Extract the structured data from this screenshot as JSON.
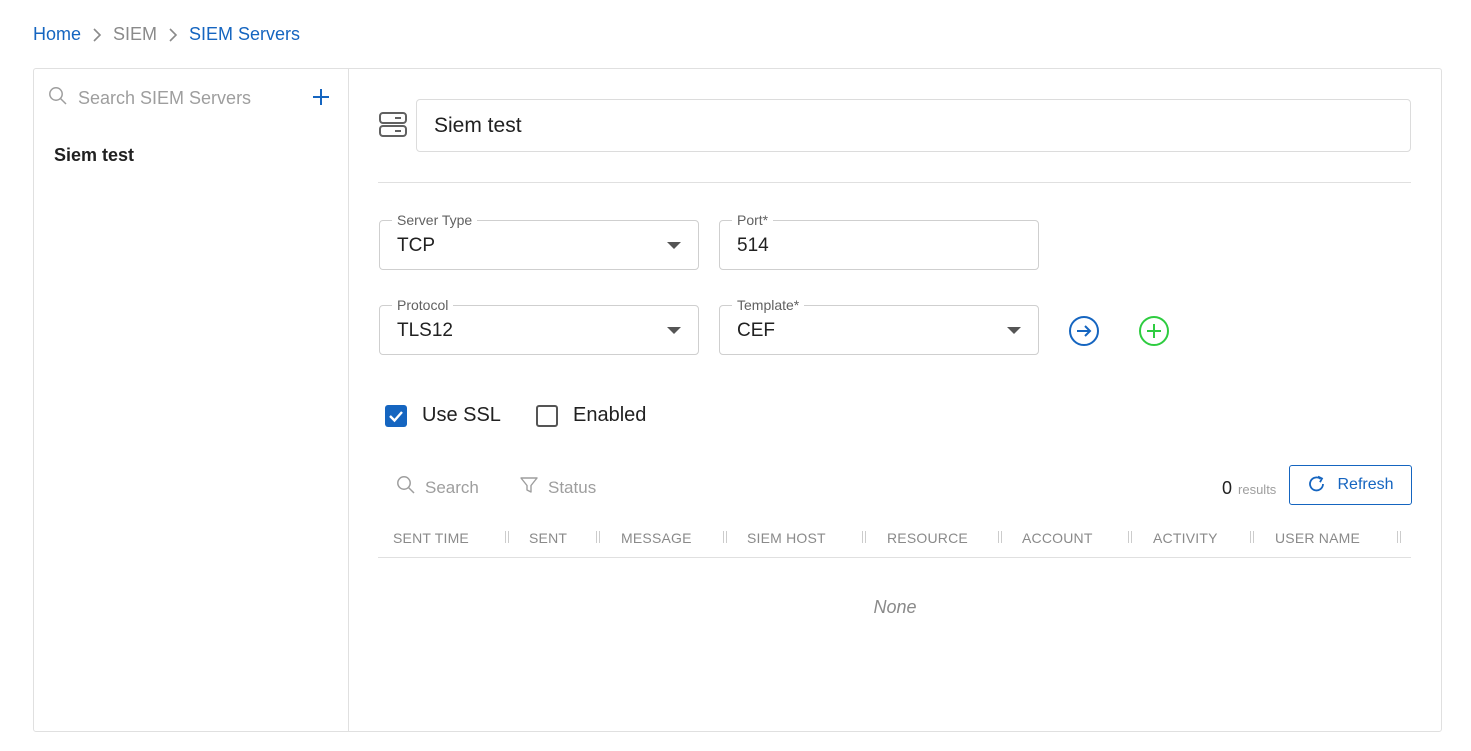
{
  "breadcrumb": [
    {
      "label": "Home"
    },
    {
      "label": "SIEM"
    },
    {
      "label": "SIEM Servers"
    }
  ],
  "sidebar": {
    "search_placeholder": "Search SIEM Servers",
    "items": [
      {
        "label": "Siem test"
      }
    ]
  },
  "server": {
    "name": "Siem test"
  },
  "form": {
    "server_type": {
      "label": "Server Type",
      "value": "TCP"
    },
    "port": {
      "label": "Port*",
      "value": "514"
    },
    "protocol": {
      "label": "Protocol",
      "value": "TLS12"
    },
    "template": {
      "label": "Template*",
      "value": "CEF"
    },
    "use_ssl": {
      "label": "Use SSL",
      "checked": true
    },
    "enabled": {
      "label": "Enabled",
      "checked": false
    }
  },
  "table": {
    "search_label": "Search",
    "status_label": "Status",
    "results_count": "0",
    "results_label": "results",
    "refresh_label": "Refresh",
    "columns": [
      "SENT TIME",
      "SENT",
      "MESSAGE",
      "SIEM HOST",
      "RESOURCE",
      "ACCOUNT",
      "ACTIVITY",
      "USER NAME"
    ],
    "empty_text": "None"
  },
  "colors": {
    "accent": "#1565c0",
    "add_green": "#2ecc40",
    "border": "#e0e0e0"
  },
  "icons": {
    "search": "search-icon",
    "add": "plus-icon",
    "server": "server-icon",
    "navigate": "arrow-right-circle-icon",
    "add_template": "plus-circle-icon",
    "filter": "filter-icon",
    "refresh": "refresh-icon"
  }
}
